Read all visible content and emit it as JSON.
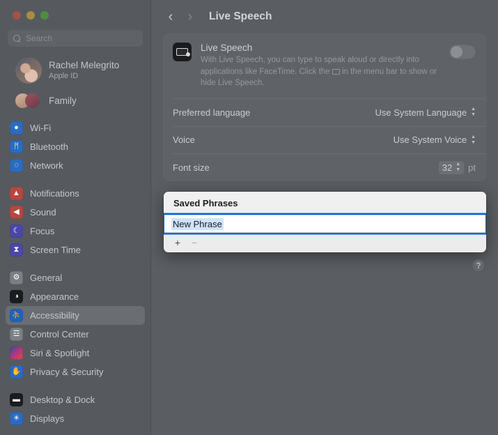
{
  "window": {
    "traffic_lights": [
      "close",
      "minimize",
      "zoom"
    ]
  },
  "sidebar": {
    "search": {
      "placeholder": "Search",
      "icon": "search-icon"
    },
    "account": {
      "name": "Rachel Melegrito",
      "subtitle": "Apple ID"
    },
    "family": {
      "label": "Family"
    },
    "groups": [
      {
        "items": [
          {
            "label": "Wi-Fi",
            "icon": "wifi-icon",
            "cls": "ic-wifi",
            "glyph": "●"
          },
          {
            "label": "Bluetooth",
            "icon": "bluetooth-icon",
            "cls": "ic-bt",
            "glyph": "ᛗ"
          },
          {
            "label": "Network",
            "icon": "network-icon",
            "cls": "ic-net",
            "glyph": "◌"
          }
        ]
      },
      {
        "items": [
          {
            "label": "Notifications",
            "icon": "notifications-icon",
            "cls": "ic-notif",
            "glyph": "▲"
          },
          {
            "label": "Sound",
            "icon": "sound-icon",
            "cls": "ic-sound",
            "glyph": "◀"
          },
          {
            "label": "Focus",
            "icon": "focus-icon",
            "cls": "ic-focus",
            "glyph": "☾"
          },
          {
            "label": "Screen Time",
            "icon": "screen-time-icon",
            "cls": "ic-screen",
            "glyph": "⧗"
          }
        ]
      },
      {
        "items": [
          {
            "label": "General",
            "icon": "general-icon",
            "cls": "ic-general",
            "glyph": "⚙"
          },
          {
            "label": "Appearance",
            "icon": "appearance-icon",
            "cls": "ic-appear",
            "glyph": "◑"
          },
          {
            "label": "Accessibility",
            "icon": "accessibility-icon",
            "cls": "ic-access",
            "glyph": "⛹",
            "selected": true
          },
          {
            "label": "Control Center",
            "icon": "control-center-icon",
            "cls": "ic-control",
            "glyph": "☲"
          },
          {
            "label": "Siri & Spotlight",
            "icon": "siri-icon",
            "cls": "ic-siri",
            "glyph": ""
          },
          {
            "label": "Privacy & Security",
            "icon": "privacy-icon",
            "cls": "ic-privacy",
            "glyph": "✋"
          }
        ]
      },
      {
        "items": [
          {
            "label": "Desktop & Dock",
            "icon": "desktop-dock-icon",
            "cls": "ic-desk",
            "glyph": "▬"
          },
          {
            "label": "Displays",
            "icon": "displays-icon",
            "cls": "ic-disp",
            "glyph": "☀"
          }
        ]
      }
    ]
  },
  "detail": {
    "back_icon": "chevron-left-icon",
    "forward_icon": "chevron-right-icon",
    "title": "Live Speech",
    "hero": {
      "icon": "live-speech-app-icon",
      "title": "Live Speech",
      "description_part1": "With Live Speech, you can type to speak aloud or directly into applications like FaceTime. Click the ",
      "description_part2": " in the menu bar to show or hide Live Speech.",
      "toggle_state": "off"
    },
    "rows": [
      {
        "label": "Preferred language",
        "value": "Use System Language",
        "control": "popup-button"
      },
      {
        "label": "Voice",
        "value": "Use System Voice",
        "control": "popup-button"
      }
    ],
    "font_size": {
      "label": "Font size",
      "value": "32",
      "unit": "pt",
      "control": "stepper"
    },
    "help_label": "?"
  },
  "sheet": {
    "title": "Saved Phrases",
    "phrase_field": {
      "value": "New Phrase",
      "selected": true,
      "focused": true
    },
    "add_label": "+",
    "remove_label": "−"
  }
}
